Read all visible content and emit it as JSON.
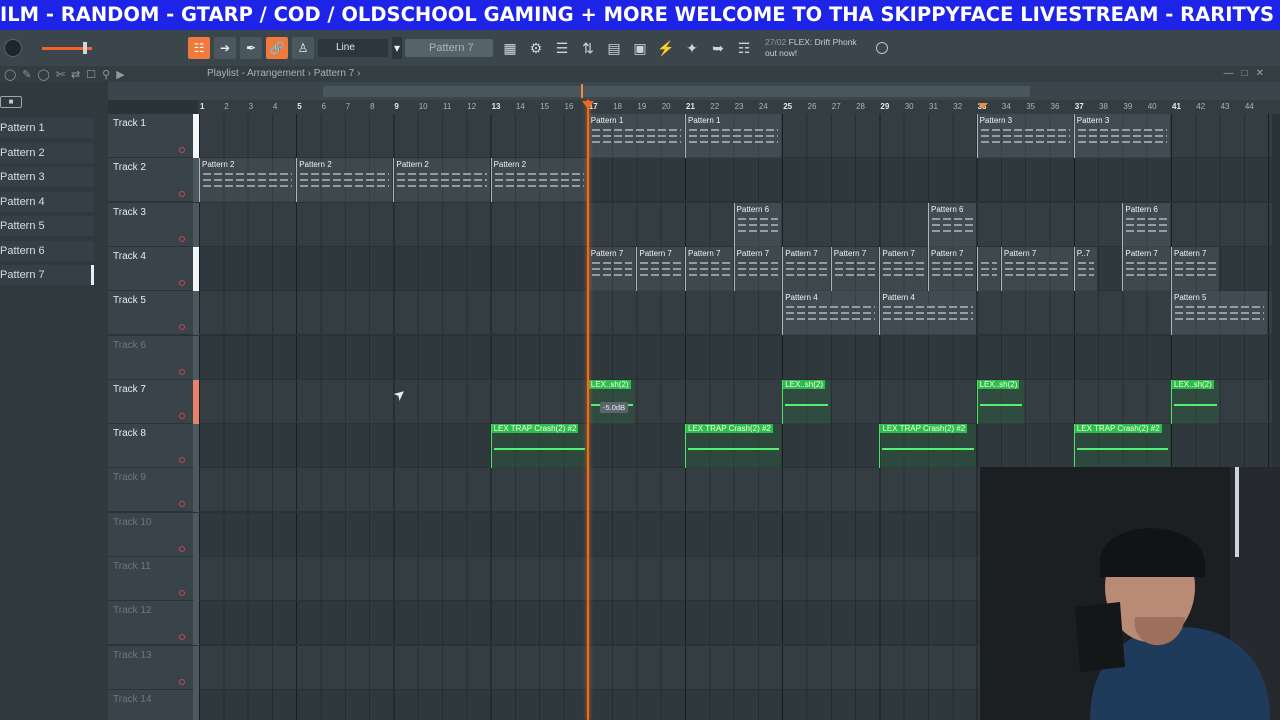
{
  "ticker": {
    "text": "ILM - RANDOM - GTARP / COD / OLDSCHOOL GAMING + MORE  WELCOME TO THA SKIPPYFACE LIVESTREAM  - RARITYS AND"
  },
  "toolbar": {
    "snap_label": "Line",
    "pattern_selector": "Pattern 7",
    "news_date": "27/02",
    "news_text": "FLEX: Drift Phonk",
    "news_sub": "out now!"
  },
  "playlist": {
    "title": "Playlist - Arrangement › Pattern 7 ›"
  },
  "picker": {
    "items": [
      "Pattern 1",
      "Pattern 2",
      "Pattern 3",
      "Pattern 4",
      "Pattern 5",
      "Pattern 6",
      "Pattern 7"
    ],
    "selected": "Pattern 7"
  },
  "ruler": {
    "bars": [
      "1",
      "2",
      "3",
      "4",
      "5",
      "6",
      "7",
      "8",
      "9",
      "10",
      "11",
      "12",
      "13",
      "14",
      "15",
      "16",
      "17",
      "18",
      "19",
      "20",
      "21",
      "22",
      "23",
      "24",
      "25",
      "26",
      "27",
      "28",
      "29",
      "30",
      "31",
      "32",
      "33",
      "34",
      "35",
      "36",
      "37",
      "38",
      "39",
      "40",
      "41",
      "42",
      "43",
      "44"
    ]
  },
  "tracks": [
    {
      "name": "Track 1",
      "muted": false,
      "grip": "white"
    },
    {
      "name": "Track 2",
      "muted": false,
      "grip": "grey"
    },
    {
      "name": "Track 3",
      "muted": false,
      "grip": "grey"
    },
    {
      "name": "Track 4",
      "muted": false,
      "grip": "white"
    },
    {
      "name": "Track 5",
      "muted": false,
      "grip": "grey"
    },
    {
      "name": "Track 6",
      "muted": true,
      "grip": "grey"
    },
    {
      "name": "Track 7",
      "muted": false,
      "grip": "orange"
    },
    {
      "name": "Track 8",
      "muted": false,
      "grip": "grey"
    },
    {
      "name": "Track 9",
      "muted": true,
      "grip": "grey"
    },
    {
      "name": "Track 10",
      "muted": true,
      "grip": "grey"
    },
    {
      "name": "Track 11",
      "muted": true,
      "grip": "grey"
    },
    {
      "name": "Track 12",
      "muted": true,
      "grip": "grey"
    },
    {
      "name": "Track 13",
      "muted": true,
      "grip": "grey"
    },
    {
      "name": "Track 14",
      "muted": true,
      "grip": "grey"
    }
  ],
  "clips": [
    {
      "track": 0,
      "start": 17,
      "len": 4,
      "label": "Pattern 1",
      "kind": "pattern"
    },
    {
      "track": 0,
      "start": 21,
      "len": 4,
      "label": "Pattern 1",
      "kind": "pattern"
    },
    {
      "track": 0,
      "start": 33,
      "len": 4,
      "label": "Pattern 3",
      "kind": "pattern"
    },
    {
      "track": 0,
      "start": 37,
      "len": 4,
      "label": "Pattern 3",
      "kind": "pattern"
    },
    {
      "track": 1,
      "start": 1,
      "len": 4,
      "label": "Pattern 2",
      "kind": "pattern"
    },
    {
      "track": 1,
      "start": 5,
      "len": 4,
      "label": "Pattern 2",
      "kind": "pattern"
    },
    {
      "track": 1,
      "start": 9,
      "len": 4,
      "label": "Pattern 2",
      "kind": "pattern"
    },
    {
      "track": 1,
      "start": 13,
      "len": 4,
      "label": "Pattern 2",
      "kind": "pattern"
    },
    {
      "track": 2,
      "start": 23,
      "len": 2,
      "label": "Pattern 6",
      "kind": "pattern"
    },
    {
      "track": 2,
      "start": 31,
      "len": 2,
      "label": "Pattern 6",
      "kind": "pattern"
    },
    {
      "track": 2,
      "start": 39,
      "len": 2,
      "label": "Pattern 6",
      "kind": "pattern"
    },
    {
      "track": 3,
      "start": 17,
      "len": 2,
      "label": "Pattern 7",
      "kind": "pattern"
    },
    {
      "track": 3,
      "start": 19,
      "len": 2,
      "label": "Pattern 7",
      "kind": "pattern"
    },
    {
      "track": 3,
      "start": 21,
      "len": 2,
      "label": "Pattern 7",
      "kind": "pattern"
    },
    {
      "track": 3,
      "start": 23,
      "len": 2,
      "label": "Pattern 7",
      "kind": "pattern"
    },
    {
      "track": 3,
      "start": 25,
      "len": 2,
      "label": "Pattern 7",
      "kind": "pattern"
    },
    {
      "track": 3,
      "start": 27,
      "len": 2,
      "label": "Pattern 7",
      "kind": "pattern"
    },
    {
      "track": 3,
      "start": 29,
      "len": 2,
      "label": "Pattern 7",
      "kind": "pattern"
    },
    {
      "track": 3,
      "start": 31,
      "len": 2,
      "label": "Pattern 7",
      "kind": "pattern"
    },
    {
      "track": 3,
      "start": 33,
      "len": 1,
      "label": "",
      "kind": "pattern"
    },
    {
      "track": 3,
      "start": 34,
      "len": 3,
      "label": "Pattern 7",
      "kind": "pattern"
    },
    {
      "track": 3,
      "start": 37,
      "len": 1,
      "label": "P..7",
      "kind": "pattern"
    },
    {
      "track": 3,
      "start": 39,
      "len": 2,
      "label": "Pattern 7",
      "kind": "pattern"
    },
    {
      "track": 3,
      "start": 41,
      "len": 2,
      "label": "Pattern 7",
      "kind": "pattern"
    },
    {
      "track": 4,
      "start": 25,
      "len": 4,
      "label": "Pattern 4",
      "kind": "pattern"
    },
    {
      "track": 4,
      "start": 29,
      "len": 4,
      "label": "Pattern 4",
      "kind": "pattern"
    },
    {
      "track": 4,
      "start": 41,
      "len": 4,
      "label": "Pattern 5",
      "kind": "pattern"
    },
    {
      "track": 6,
      "start": 17,
      "len": 2,
      "label": "LEX..sh(2)",
      "kind": "audio"
    },
    {
      "track": 6,
      "start": 25,
      "len": 2,
      "label": "LEX..sh(2)",
      "kind": "audio"
    },
    {
      "track": 6,
      "start": 33,
      "len": 2,
      "label": "LEX..sh(2)",
      "kind": "audio"
    },
    {
      "track": 6,
      "start": 41,
      "len": 2,
      "label": "LEX..sh(2)",
      "kind": "audio"
    },
    {
      "track": 7,
      "start": 13,
      "len": 4,
      "label": "LEX TRAP Crash(2) #2",
      "kind": "audio"
    },
    {
      "track": 7,
      "start": 21,
      "len": 4,
      "label": "LEX TRAP Crash(2) #2",
      "kind": "audio"
    },
    {
      "track": 7,
      "start": 29,
      "len": 4,
      "label": "LEX TRAP Crash(2) #2",
      "kind": "audio"
    },
    {
      "track": 7,
      "start": 37,
      "len": 4,
      "label": "LEX TRAP Crash(2) #2",
      "kind": "audio"
    }
  ],
  "volume_tooltip": "-5.0dB",
  "icons": {
    "hint_bar": "hint-icon",
    "browser": "browser-icon",
    "mixer": "mixer-icon"
  },
  "colors": {
    "ticker_bg": "#1e23e8",
    "accent": "#f26a1c",
    "audio_clip": "#2fbd4a"
  }
}
